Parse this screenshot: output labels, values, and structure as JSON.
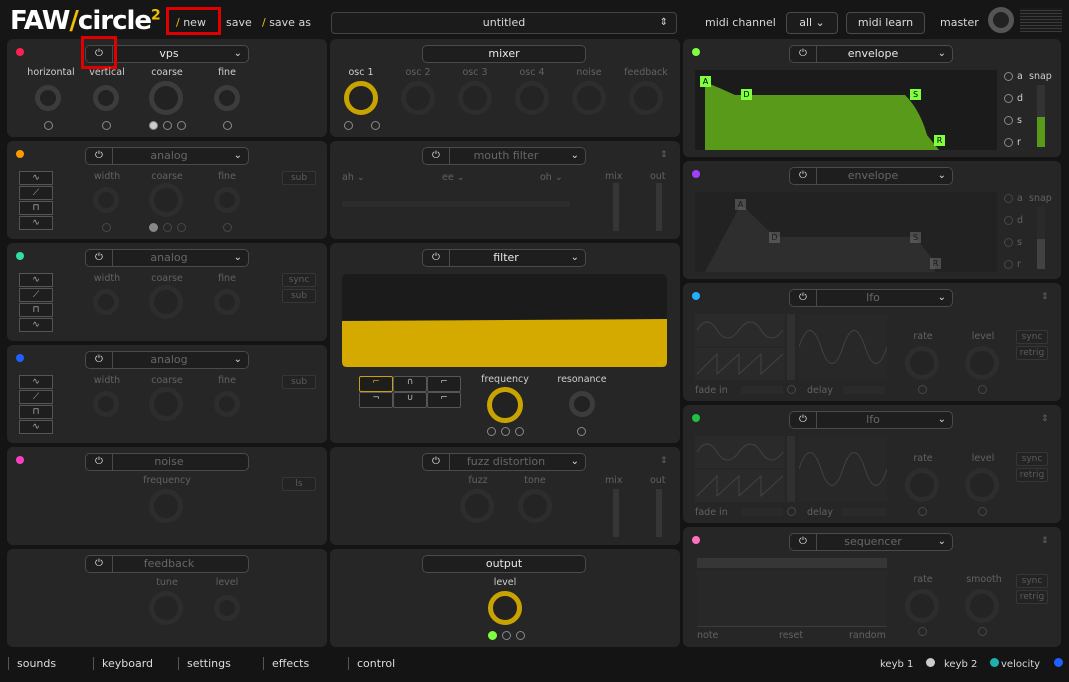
{
  "top": {
    "logo_main": "FAW",
    "logo_slash": "/",
    "logo_rest": "circle",
    "logo_sup": "2",
    "new_label": "new",
    "save_label": "save",
    "saveas_label": "save as",
    "preset_name": "untitled",
    "midi_channel_label": "midi channel",
    "midi_channel_value": "all",
    "midi_learn_label": "midi learn",
    "master_label": "master"
  },
  "osc1": {
    "title": "vps",
    "knobs": [
      "horizontal",
      "vertical",
      "coarse",
      "fine"
    ]
  },
  "osc2": {
    "title": "analog",
    "knobs": [
      "width",
      "coarse",
      "fine"
    ],
    "sub": "sub"
  },
  "osc3": {
    "title": "analog",
    "knobs": [
      "width",
      "coarse",
      "fine"
    ],
    "sync": "sync",
    "sub": "sub"
  },
  "osc4": {
    "title": "analog",
    "knobs": [
      "width",
      "coarse",
      "fine"
    ],
    "sub": "sub"
  },
  "noise": {
    "title": "noise",
    "knob": "frequency",
    "ls": "ls"
  },
  "feedback": {
    "title": "feedback",
    "knobs": [
      "tune",
      "level"
    ]
  },
  "mixer": {
    "title": "mixer",
    "channels": [
      "osc 1",
      "osc 2",
      "osc 3",
      "osc 4",
      "noise",
      "feedback"
    ]
  },
  "mouth": {
    "title": "mouth filter",
    "v1": "ah",
    "v2": "ee",
    "v3": "oh",
    "mix": "mix",
    "out": "out"
  },
  "filter": {
    "title": "filter",
    "frequency": "frequency",
    "resonance": "resonance"
  },
  "fuzz": {
    "title": "fuzz distortion",
    "fuzz": "fuzz",
    "tone": "tone",
    "mix": "mix",
    "out": "out"
  },
  "output": {
    "title": "output",
    "level": "level"
  },
  "env1": {
    "title": "envelope",
    "a": "a",
    "d": "d",
    "s": "s",
    "r": "r",
    "snap": "snap",
    "pts": [
      "A",
      "D",
      "S",
      "R"
    ]
  },
  "env2": {
    "title": "envelope",
    "a": "a",
    "d": "d",
    "s": "s",
    "r": "r",
    "snap": "snap",
    "pts": [
      "A",
      "D",
      "S",
      "R"
    ]
  },
  "lfo1": {
    "title": "lfo",
    "fadein": "fade in",
    "delay": "delay",
    "rate": "rate",
    "level": "level",
    "sync": "sync",
    "retrig": "retrig"
  },
  "lfo2": {
    "title": "lfo",
    "fadein": "fade in",
    "delay": "delay",
    "rate": "rate",
    "level": "level",
    "sync": "sync",
    "retrig": "retrig"
  },
  "seq": {
    "title": "sequencer",
    "rate": "rate",
    "smooth": "smooth",
    "sync": "sync",
    "retrig": "retrig",
    "b1": "note",
    "b2": "reset",
    "b3": "random"
  },
  "bottom": {
    "tabs": [
      "sounds",
      "keyboard",
      "settings",
      "effects",
      "control"
    ],
    "keyb1": "keyb 1",
    "keyb2": "keyb 2",
    "velocity": "velocity"
  },
  "colors": {
    "accent": "#f0c000",
    "env_green": "#5a9a1a",
    "filter_yellow": "#d4aa00",
    "highlight": "#e00000"
  }
}
